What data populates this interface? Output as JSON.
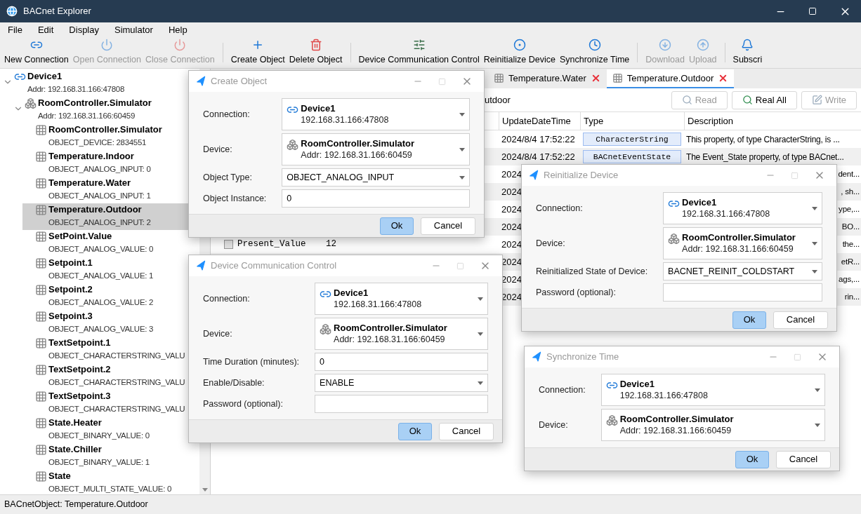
{
  "window": {
    "title": "BACnet Explorer"
  },
  "menu": [
    "File",
    "Edit",
    "Display",
    "Simulator",
    "Help"
  ],
  "toolbar": [
    {
      "label": "New Connection",
      "disabled": false
    },
    {
      "label": "Open Connection",
      "disabled": true
    },
    {
      "label": "Close Connection",
      "disabled": true
    },
    {
      "label": "Create Object",
      "disabled": false
    },
    {
      "label": "Delete Object",
      "disabled": false
    },
    {
      "label": "Device Communication Control",
      "disabled": false
    },
    {
      "label": "Reinitialize Device",
      "disabled": false
    },
    {
      "label": "Synchronize Time",
      "disabled": false
    },
    {
      "label": "Download",
      "disabled": true
    },
    {
      "label": "Upload",
      "disabled": true
    },
    {
      "label": "Subscri",
      "disabled": false
    }
  ],
  "tree": [
    {
      "name": "Device1",
      "detail": "Addr: 192.168.31.166:47808",
      "kind": "connection",
      "expanded": true,
      "selected": false,
      "children": [
        {
          "name": "RoomController.Simulator",
          "detail": "Addr: 192.168.31.166:60459",
          "kind": "device",
          "expanded": true,
          "selected": false,
          "children": [
            {
              "name": "RoomController.Simulator",
              "detail": "OBJECT_DEVICE: 2834551",
              "kind": "object",
              "selected": false
            },
            {
              "name": "Temperature.Indoor",
              "detail": "OBJECT_ANALOG_INPUT: 0",
              "kind": "object",
              "selected": false
            },
            {
              "name": "Temperature.Water",
              "detail": "OBJECT_ANALOG_INPUT: 1",
              "kind": "object",
              "selected": false
            },
            {
              "name": "Temperature.Outdoor",
              "detail": "OBJECT_ANALOG_INPUT: 2",
              "kind": "object",
              "selected": true
            },
            {
              "name": "SetPoint.Value",
              "detail": "OBJECT_ANALOG_VALUE: 0",
              "kind": "object",
              "selected": false
            },
            {
              "name": "Setpoint.1",
              "detail": "OBJECT_ANALOG_VALUE: 1",
              "kind": "object",
              "selected": false
            },
            {
              "name": "Setpoint.2",
              "detail": "OBJECT_ANALOG_VALUE: 2",
              "kind": "object",
              "selected": false
            },
            {
              "name": "Setpoint.3",
              "detail": "OBJECT_ANALOG_VALUE: 3",
              "kind": "object",
              "selected": false
            },
            {
              "name": "TextSetpoint.1",
              "detail": "OBJECT_CHARACTERSTRING_VALU",
              "kind": "object",
              "selected": false
            },
            {
              "name": "TextSetpoint.2",
              "detail": "OBJECT_CHARACTERSTRING_VALU",
              "kind": "object",
              "selected": false
            },
            {
              "name": "TextSetpoint.3",
              "detail": "OBJECT_CHARACTERSTRING_VALU",
              "kind": "object",
              "selected": false
            },
            {
              "name": "State.Heater",
              "detail": "OBJECT_BINARY_VALUE: 0",
              "kind": "object",
              "selected": false
            },
            {
              "name": "State.Chiller",
              "detail": "OBJECT_BINARY_VALUE: 1",
              "kind": "object",
              "selected": false
            },
            {
              "name": "State",
              "detail": "OBJECT_MULTI_STATE_VALUE: 0",
              "kind": "object",
              "selected": false
            }
          ]
        }
      ]
    }
  ],
  "tabs": [
    {
      "label": "Temperature.Water",
      "selected": false
    },
    {
      "label": "Temperature.Outdoor",
      "selected": true
    }
  ],
  "object_bar": {
    "path": "utdoor",
    "buttons": [
      {
        "label": "Read",
        "disabled": true
      },
      {
        "label": "Real All",
        "disabled": false
      },
      {
        "label": "Write",
        "disabled": true
      }
    ]
  },
  "table": {
    "columns": [
      "UpdateDateTime",
      "Type",
      "Description"
    ],
    "rows": [
      {
        "updated": "2024/8/4 17:52:22",
        "type": "CharacterString",
        "description": "This property, of type CharacterString, is ..."
      },
      {
        "updated": "2024/8/4 17:52:22",
        "type": "BACnetEventState",
        "description": "The Event_State property, of type BACnet..."
      },
      {
        "updated": "2024",
        "description": "dent..."
      },
      {
        "updated": "2024",
        "description": ", sh..."
      },
      {
        "updated": "2024",
        "description": "ype,..."
      },
      {
        "updated": "2024",
        "description": "BO..."
      },
      {
        "name": "Present_Value",
        "value": "12",
        "checked": false,
        "updated": "2024",
        "description": "the..."
      },
      {
        "updated": "2024",
        "description": "etR..."
      },
      {
        "updated": "2024",
        "description": "ags,..."
      },
      {
        "updated": "2024",
        "description": "rin..."
      }
    ]
  },
  "status_bar": "BACnetObject: Temperature.Outdoor",
  "dialogs": [
    {
      "title": "Create Object",
      "fields": [
        {
          "label": "Connection:",
          "kind": "connection",
          "name": "Device1",
          "detail": "192.168.31.166:47808"
        },
        {
          "label": "Device:",
          "kind": "device",
          "name": "RoomController.Simulator",
          "detail": "Addr: 192.168.31.166:60459"
        },
        {
          "label": "Object Type:",
          "kind": "select",
          "value": "OBJECT_ANALOG_INPUT"
        },
        {
          "label": "Object Instance:",
          "kind": "input",
          "value": "0"
        }
      ],
      "buttons": [
        {
          "label": "Ok",
          "default": true
        },
        {
          "label": "Cancel",
          "default": false
        }
      ]
    },
    {
      "title": "Device Communication Control",
      "fields": [
        {
          "label": "Connection:",
          "kind": "connection",
          "name": "Device1",
          "detail": "192.168.31.166:47808"
        },
        {
          "label": "Device:",
          "kind": "device",
          "name": "RoomController.Simulator",
          "detail": "Addr: 192.168.31.166:60459"
        },
        {
          "label": "Time Duration (minutes):",
          "kind": "input",
          "value": "0"
        },
        {
          "label": "Enable/Disable:",
          "kind": "select",
          "value": "ENABLE"
        },
        {
          "label": "Password (optional):",
          "kind": "input"
        }
      ],
      "buttons": [
        {
          "label": "Ok",
          "default": true
        },
        {
          "label": "Cancel",
          "default": false
        }
      ]
    },
    {
      "title": "Reinitialize Device",
      "fields": [
        {
          "label": "Connection:",
          "kind": "connection",
          "name": "Device1",
          "detail": "192.168.31.166:47808"
        },
        {
          "label": "Device:",
          "kind": "device",
          "name": "RoomController.Simulator",
          "detail": "Addr: 192.168.31.166:60459"
        },
        {
          "label": "Reinitialized State of Device:",
          "kind": "select",
          "value": "BACNET_REINIT_COLDSTART"
        },
        {
          "label": "Password (optional):",
          "kind": "input"
        }
      ],
      "buttons": [
        {
          "label": "Ok",
          "default": true
        },
        {
          "label": "Cancel",
          "default": false
        }
      ]
    },
    {
      "title": "Synchronize Time",
      "fields": [
        {
          "label": "Connection:",
          "kind": "connection",
          "name": "Device1",
          "detail": "192.168.31.166:47808"
        },
        {
          "label": "Device:",
          "kind": "device",
          "name": "RoomController.Simulator",
          "detail": "Addr: 192.168.31.166:60459"
        }
      ],
      "buttons": [
        {
          "label": "Ok",
          "default": true
        },
        {
          "label": "Cancel",
          "default": false
        }
      ]
    }
  ]
}
